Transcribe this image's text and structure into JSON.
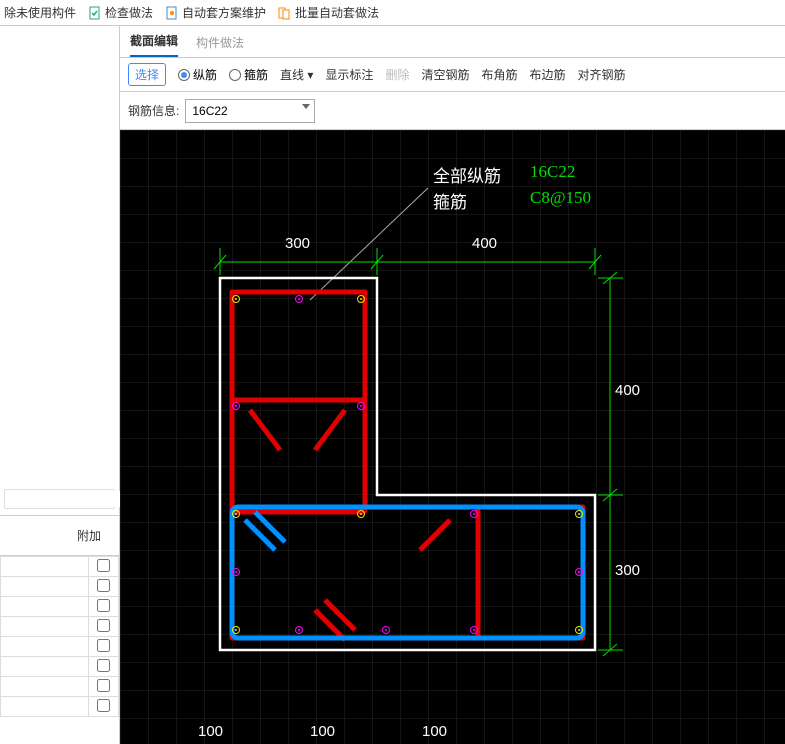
{
  "toolbar": {
    "unused": "除未使用构件",
    "check": "检查做法",
    "scheme": "自动套方案维护",
    "batch": "批量自动套做法"
  },
  "tabs": {
    "section": "截面编辑",
    "component": "构件做法"
  },
  "options": {
    "select": "选择",
    "longitudinal": "纵筋",
    "stirrup": "箍筋",
    "line": "直线",
    "showLabel": "显示标注",
    "delete": "删除",
    "clear": "清空钢筋",
    "corner": "布角筋",
    "edge": "布边筋",
    "align": "对齐钢筋"
  },
  "info": {
    "label": "钢筋信息:",
    "value": "16C22"
  },
  "leftHeader": "附加",
  "annotations": {
    "allLongLabel": "全部纵筋",
    "allLongValue": "16C22",
    "stirrupLabel": "箍筋",
    "stirrupValue": "C8@150"
  },
  "dimensions": {
    "top1": "300",
    "top2": "400",
    "right1": "400",
    "right2": "300",
    "bot1": "100",
    "bot2": "100",
    "bot3": "100"
  },
  "chart_data": {
    "type": "diagram",
    "description": "L-shaped column cross-section rebar layout",
    "section_outline_mm": "L-shape: 300 wide upper leg, 700 wide lower, heights 400 upper + 300 lower",
    "longitudinal_rebar": "16C22",
    "stirrups": "C8@150",
    "stirrup_loops": [
      {
        "color": "red",
        "shape": "outer L following section perimeter"
      },
      {
        "color": "red",
        "shape": "upper rectangle inside 300 leg"
      },
      {
        "color": "blue",
        "shape": "lower rectangle 700x300 portion"
      }
    ],
    "dimensions_mm": {
      "upper_width": 300,
      "lower_extra_width": 400,
      "upper_height": 400,
      "lower_height": 300
    }
  }
}
